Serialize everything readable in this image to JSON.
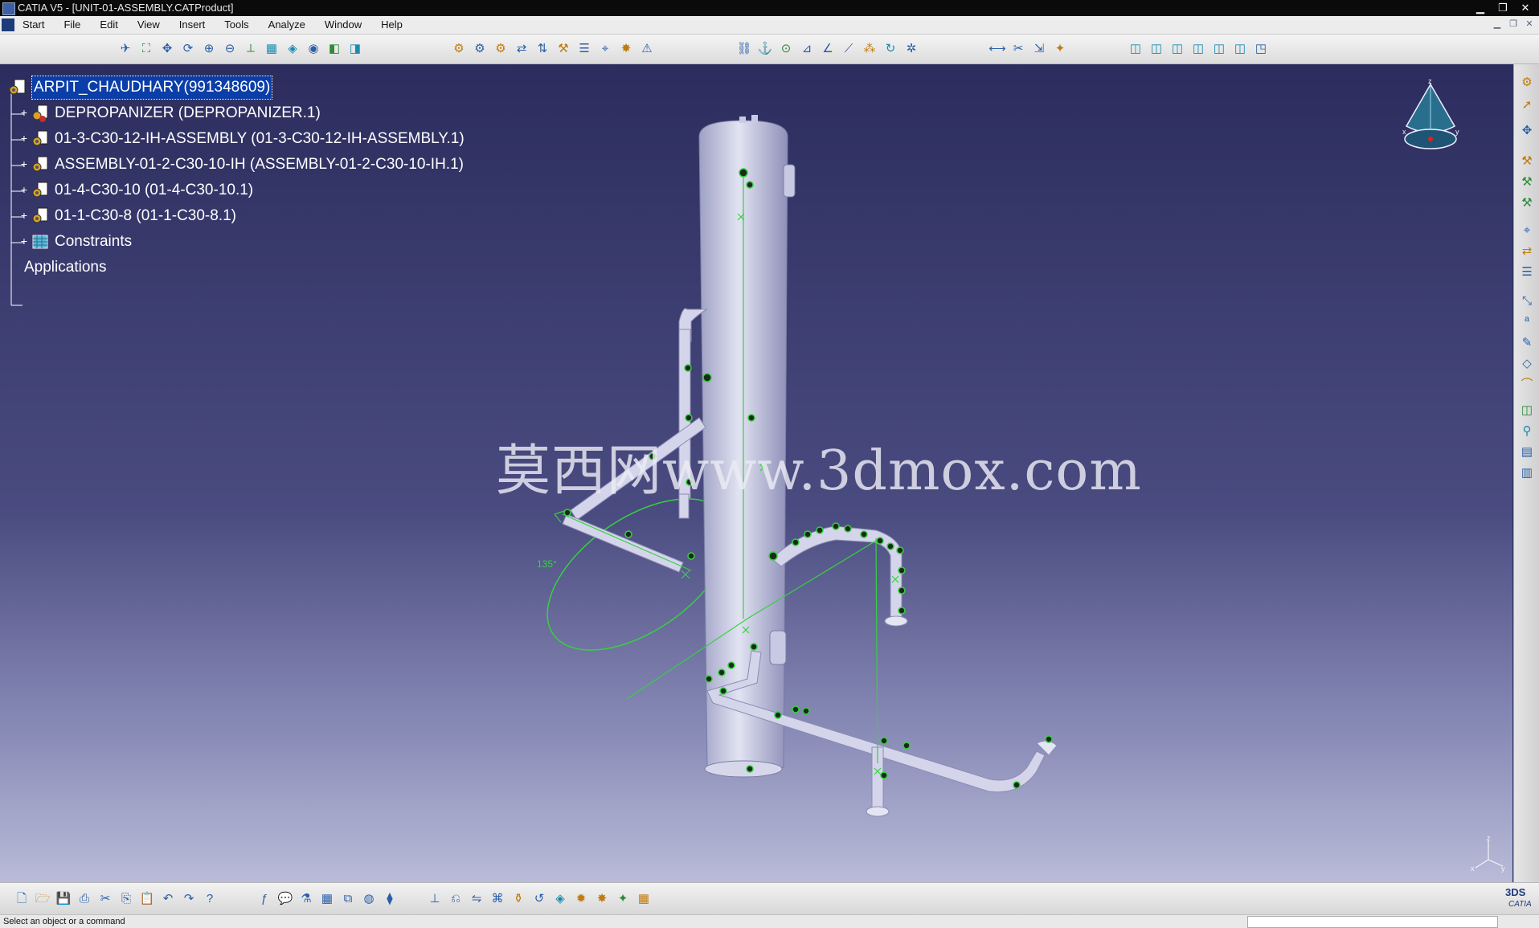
{
  "window": {
    "title": "CATIA V5 - [UNIT-01-ASSEMBLY.CATProduct]",
    "minimize": "▁",
    "restore": "❐",
    "close": "✕"
  },
  "menu": {
    "items": [
      "Start",
      "File",
      "Edit",
      "View",
      "Insert",
      "Tools",
      "Analyze",
      "Window",
      "Help"
    ],
    "mdi_min": "▁",
    "mdi_restore": "❐",
    "mdi_close": "✕"
  },
  "tree": {
    "root": "ARPIT_CHAUDHARY(991348609)",
    "children": [
      "DEPROPANIZER (DEPROPANIZER.1)",
      "01-3-C30-12-IH-ASSEMBLY (01-3-C30-12-IH-ASSEMBLY.1)",
      "ASSEMBLY-01-2-C30-10-IH (ASSEMBLY-01-2-C30-10-IH.1)",
      "01-4-C30-10 (01-4-C30-10.1)",
      "01-1-C30-8 (01-1-C30-8.1)",
      "Constraints",
      "Applications"
    ],
    "expand_glyph": "+"
  },
  "viewport": {
    "watermark": "莫西网www.3dmox.com",
    "angle_label": "135°",
    "compass_labels": {
      "z": "z",
      "x": "x",
      "y": "y"
    },
    "small_axis_labels": {
      "z": "z",
      "x": "x",
      "y": "y"
    }
  },
  "branding": {
    "catia": "CATIA",
    "ds": "3DS"
  },
  "status": {
    "message": "Select an object or a command"
  },
  "colors": {
    "background_top": "#2c2d5e",
    "background_bottom": "#b9bbd8",
    "selection": "#0b3ea8",
    "geometry": "#c8c9e3",
    "constraint_green": "#37d040"
  },
  "toolbar_icons": {
    "top_group1": [
      "fly-mode-icon",
      "fit-all-icon",
      "pan-icon",
      "rotate-icon",
      "zoom-in-icon",
      "zoom-out-icon",
      "normal-view-icon",
      "multi-view-icon",
      "iso-view-icon",
      "shading-icon",
      "hide-show-icon",
      "swap-space-icon"
    ],
    "top_group2": [
      "catalog-icon",
      "assembly-icon",
      "product-icon",
      "replace-icon",
      "reorder-icon",
      "graph-icon",
      "manipulate-icon",
      "snap-icon",
      "explode-icon",
      "clash-icon"
    ],
    "top_group3": [
      "constraint-icon",
      "fix-icon",
      "contact-icon",
      "offset-icon",
      "angle-icon",
      "coincidence-icon",
      "reuse-pattern-icon",
      "update-icon",
      "flexible-icon"
    ],
    "top_group4": [
      "measure-icon",
      "section-icon",
      "distance-icon",
      "clash-detect-icon"
    ],
    "top_group5": [
      "front-view-icon",
      "back-view-icon",
      "left-view-icon",
      "right-view-icon",
      "top-view-icon",
      "bottom-view-icon",
      "iso-icon"
    ],
    "bottom": [
      "new-icon",
      "open-icon",
      "save-icon",
      "print-icon",
      "cut-icon",
      "copy-icon",
      "paste-icon",
      "undo-icon",
      "redo-icon",
      "whats-this-icon",
      "formula-icon",
      "comment-icon",
      "tools-icon",
      "table-icon",
      "graph-tree-icon",
      "material-icon",
      "applied-icon",
      "compass-icon",
      "scene-icon",
      "sections-icon",
      "annotation-icon",
      "catalog-browser-icon",
      "plane-icon",
      "render-icon",
      "light-icon",
      "grid-icon"
    ],
    "right": [
      "gear-icon",
      "select-icon",
      "move-icon",
      "part-icon",
      "component-icon",
      "component2-icon",
      "snap2-icon",
      "move2-icon",
      "sheet-icon",
      "xyz-icon",
      "abc-icon",
      "drawing-icon",
      "cube-icon",
      "pipe-icon",
      "box-icon",
      "bolt-icon",
      "bookmark-icon",
      "list-icon"
    ]
  }
}
